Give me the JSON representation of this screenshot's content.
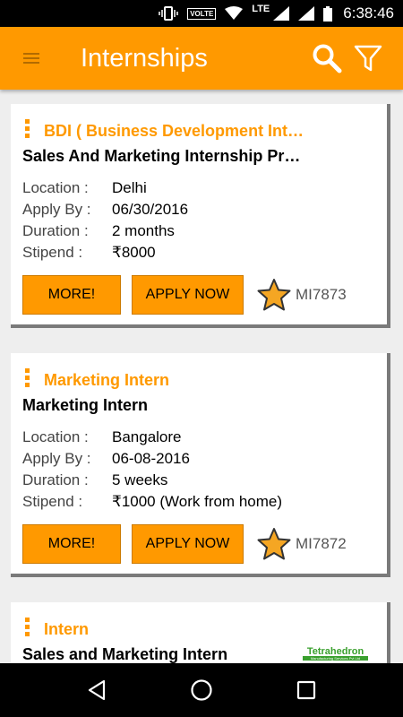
{
  "status_bar": {
    "volte": "VOLTE",
    "lte": "LTE",
    "time": "6:38:46"
  },
  "app_bar": {
    "title": "Internships",
    "icons": [
      "menu-icon",
      "search-icon",
      "filter-icon"
    ]
  },
  "labels": {
    "location": "Location :",
    "apply_by": "Apply By :",
    "duration": "Duration :",
    "stipend": "Stipend :"
  },
  "internships": [
    {
      "company": "BDI ( Business Development Int…",
      "role": "Sales And Marketing Internship Pr…",
      "location": "Delhi",
      "apply_by": "06/30/2016",
      "duration": "2 months",
      "stipend": "₹8000",
      "more_label": "MORE!",
      "apply_label": "APPLY NOW",
      "code": "MI7873"
    },
    {
      "company": "Marketing Intern",
      "role": "Marketing Intern",
      "location": "Bangalore",
      "apply_by": "06-08-2016",
      "duration": "5 weeks",
      "stipend": "₹1000 (Work from home)",
      "more_label": "MORE!",
      "apply_label": "APPLY NOW",
      "code": "MI7872"
    },
    {
      "company": "Intern",
      "role": "Sales and Marketing Intern",
      "logo_text": "Tetrahedron",
      "logo_subtext": "Manufacturing Services Pvt Ltd"
    }
  ],
  "colors": {
    "accent": "#ff9900",
    "star": "#f5a623"
  }
}
